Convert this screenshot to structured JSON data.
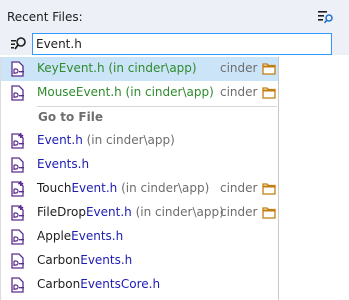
{
  "header": {
    "title": "Recent Files:"
  },
  "search": {
    "value": "Event.h"
  },
  "recent": [
    {
      "name": "KeyEvent.h (in cinder\\app)",
      "project": "cinder",
      "selected": true,
      "icon": "cpp-header-icon"
    },
    {
      "name": "MouseEvent.h (in cinder\\app)",
      "project": "cinder",
      "selected": false,
      "icon": "cpp-header-icon"
    }
  ],
  "section": {
    "title": "Go to File"
  },
  "files": [
    {
      "prefix": "",
      "match": "Event.h",
      "suffix": " (in cinder\\app)",
      "project": "",
      "folder": false,
      "icon": "cpp-header-add-icon"
    },
    {
      "prefix": "",
      "match": "Events.h",
      "suffix": "",
      "project": "",
      "folder": false,
      "icon": "cpp-header-icon"
    },
    {
      "prefix": "Touch",
      "match": "Event.h",
      "suffix": " (in cinder\\app)",
      "project": "cinder",
      "folder": true,
      "icon": "cpp-header-add-icon"
    },
    {
      "prefix": "FileDrop",
      "match": "Event.h",
      "suffix": " (in cinder\\app)",
      "project": "cinder",
      "folder": true,
      "icon": "cpp-header-add-icon"
    },
    {
      "prefix": "Apple",
      "match": "Events.h",
      "suffix": "",
      "project": "",
      "folder": false,
      "icon": "cpp-header-icon"
    },
    {
      "prefix": "Carbon",
      "match": "Events.h",
      "suffix": "",
      "project": "",
      "folder": false,
      "icon": "cpp-header-icon"
    },
    {
      "prefix": "Carbon",
      "match": "EventsCore.h",
      "suffix": "",
      "project": "",
      "folder": false,
      "icon": "cpp-header-icon"
    }
  ]
}
